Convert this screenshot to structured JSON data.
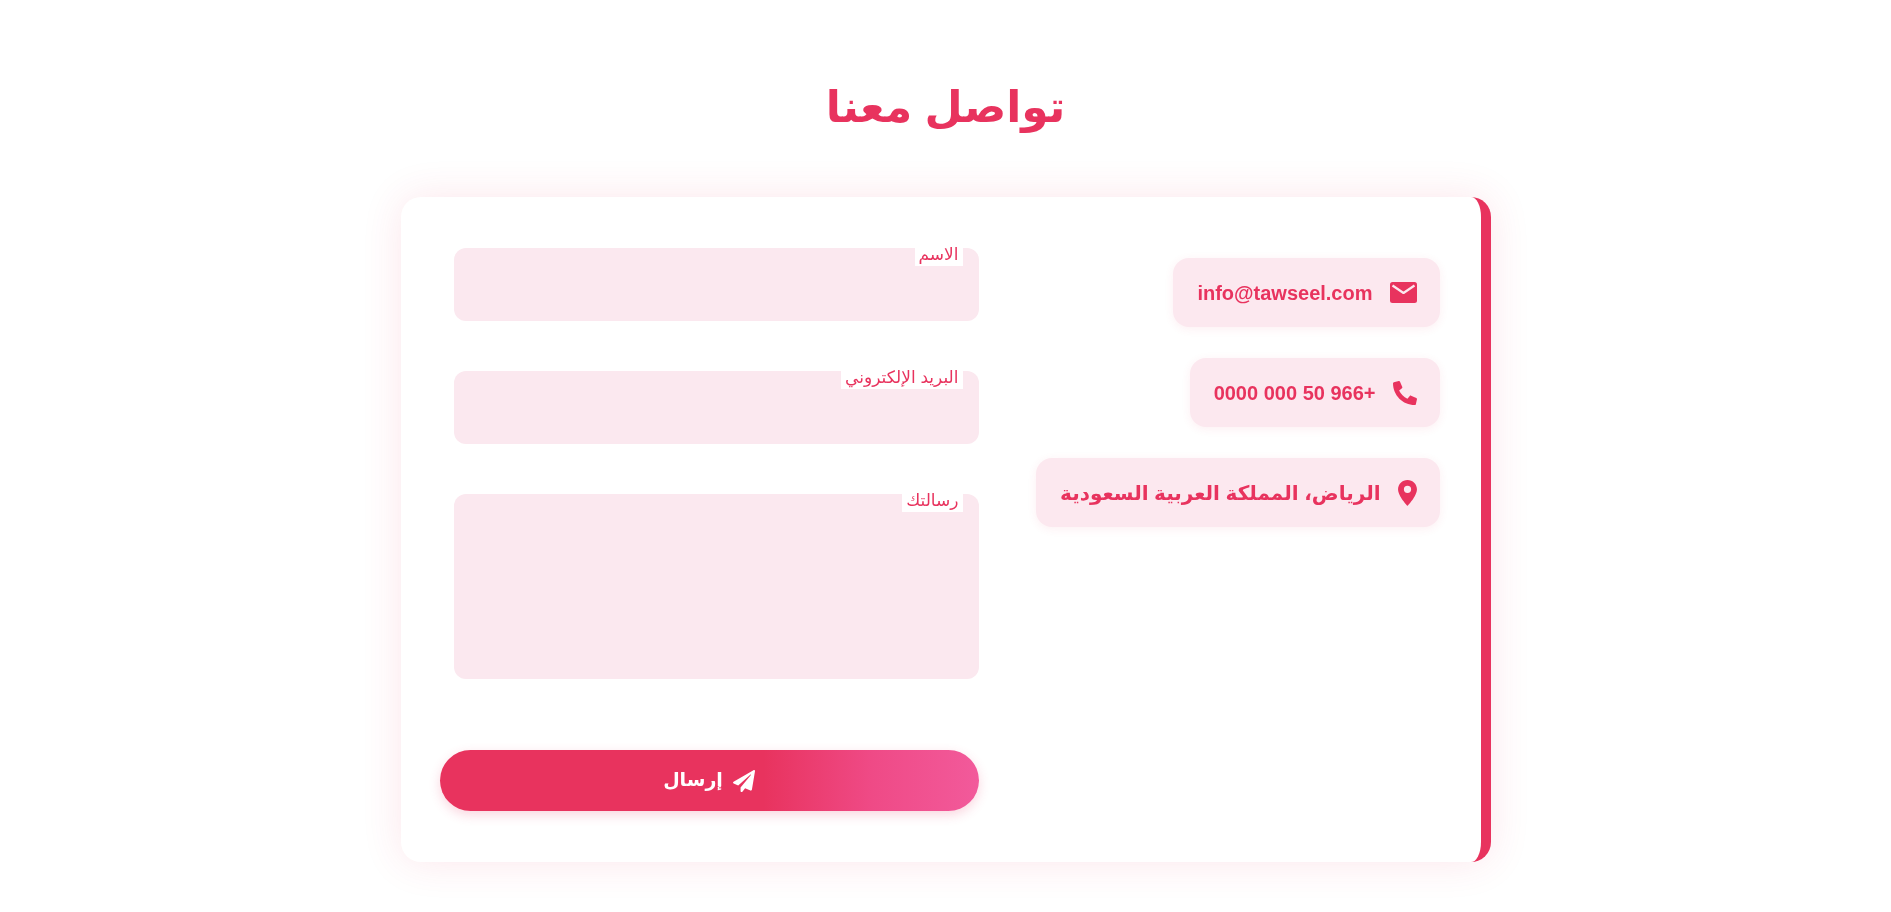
{
  "title": "تواصل معنا",
  "contact_items": [
    {
      "kind": "email",
      "text": "info@tawseel.com"
    },
    {
      "kind": "phone",
      "text": "+966 50 000 0000"
    },
    {
      "kind": "location",
      "text": "الرياض، المملكة العربية السعودية"
    }
  ],
  "form": {
    "fields": [
      {
        "kind": "input",
        "label": "الاسم"
      },
      {
        "kind": "input",
        "label": "البريد الإلكتروني"
      },
      {
        "kind": "textarea",
        "label": "رسالتك"
      }
    ],
    "submit_button": {
      "label": "إرسال"
    }
  }
}
